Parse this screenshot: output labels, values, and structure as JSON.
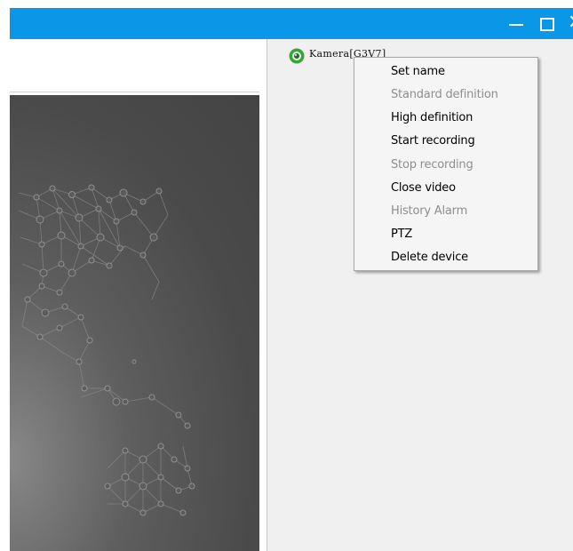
{
  "titlebar": {
    "color": "#0b97e7",
    "buttons": [
      {
        "name": "minimize-icon",
        "glyph": "—"
      },
      {
        "name": "maximize-icon",
        "glyph": "□"
      },
      {
        "name": "close-icon",
        "glyph": "✕"
      }
    ]
  },
  "device": {
    "icon": "camera-icon",
    "label": "Kamera[G3V7]"
  },
  "context_menu": {
    "items": [
      {
        "label": "Set name",
        "enabled": true
      },
      {
        "label": "Standard definition",
        "enabled": false
      },
      {
        "label": "High definition",
        "enabled": true
      },
      {
        "label": "Start recording",
        "enabled": true
      },
      {
        "label": "Stop recording",
        "enabled": false
      },
      {
        "label": "Close video",
        "enabled": true
      },
      {
        "label": "History Alarm",
        "enabled": false
      },
      {
        "label": "PTZ",
        "enabled": true
      },
      {
        "label": "Delete device",
        "enabled": true
      }
    ]
  }
}
